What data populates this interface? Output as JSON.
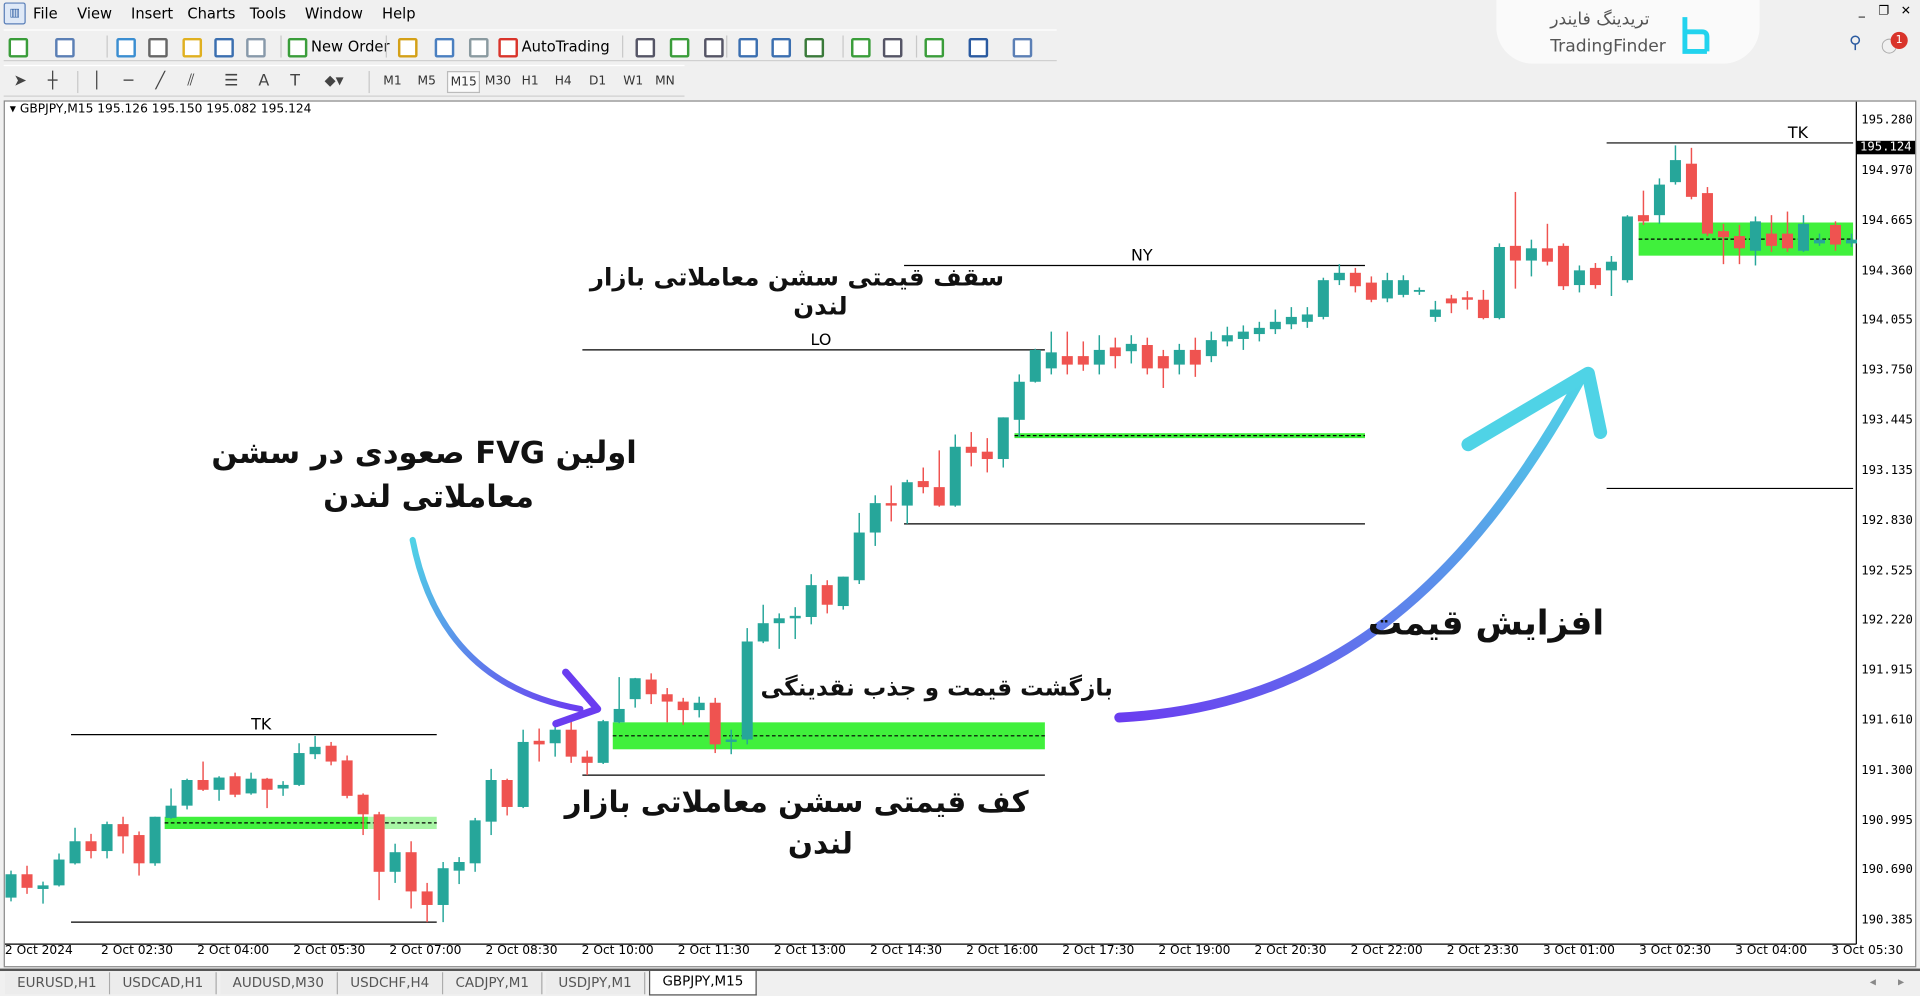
{
  "menu": {
    "items": [
      "File",
      "View",
      "Insert",
      "Charts",
      "Tools",
      "Window",
      "Help"
    ]
  },
  "window_controls": [
    "minimize",
    "restore",
    "close"
  ],
  "logo": {
    "text_fa": "تریدینگ فایندر",
    "text_en": "TradingFinder"
  },
  "notifications": {
    "count": "1"
  },
  "toolbar1": {
    "new_order": "New Order",
    "autotrading": "AutoTrading",
    "icons": [
      "new-chart-icon",
      "profiles-icon",
      "market-watch-icon",
      "data-window-icon",
      "navigator-icon",
      "terminal-icon",
      "strategy-tester-icon",
      "new-order-icon",
      "metaeditor-icon",
      "signals-icon",
      "broadcast-icon",
      "autotrading-icon",
      "bar-chart-icon",
      "candlestick-chart-icon",
      "line-chart-icon",
      "zoom-in-icon",
      "zoom-out-icon",
      "tile-windows-icon",
      "chart-shift-icon",
      "autoscroll-icon",
      "indicators-icon",
      "periods-icon",
      "templates-icon"
    ]
  },
  "toolbar2": {
    "tools": [
      "cursor-icon",
      "crosshair-icon",
      "vertical-line-icon",
      "horizontal-line-icon",
      "trendline-icon",
      "equidistant-channel-icon",
      "fibonacci-icon",
      "text-icon",
      "text-label-icon",
      "arrows-icon"
    ],
    "text_tool": "A",
    "label_tool": "T",
    "timeframes": [
      "M1",
      "M5",
      "M15",
      "M30",
      "H1",
      "H4",
      "D1",
      "W1",
      "MN"
    ],
    "active_timeframe": "M15"
  },
  "chart": {
    "symbol_info": "GBPJPY,M15  195.126 195.150 195.082 195.124"
  },
  "tabs": [
    {
      "label": "EURUSD,H1"
    },
    {
      "label": "USDCAD,H1"
    },
    {
      "label": "AUDUSD,M30"
    },
    {
      "label": "USDCHF,H4"
    },
    {
      "label": "CADJPY,M1"
    },
    {
      "label": "USDJPY,M1"
    },
    {
      "label": "GBPJPY,M15",
      "active": true
    }
  ],
  "annotations": {
    "london_high_1": "سقف قیمتی سشن معاملاتی بازار",
    "london_high_2": "لندن",
    "first_fvg_1": "اولین FVG صعودی در سشن",
    "first_fvg_2": "معاملاتی لندن",
    "pullback": "بازگشت قیمت و جذب نقدینگی",
    "london_low_1": "کف قیمتی سشن معاملاتی بازار",
    "london_low_2": "لندن",
    "price_rise": "افزایش قیمت"
  },
  "colors": {
    "bull": "#26a69a",
    "bear": "#ef5350",
    "fvg": "#40f03c",
    "fvg_mitigated": "#a8f5a5",
    "arrow_start": "#4fd3e6",
    "arrow_end": "#6a3df0"
  },
  "chart_data": {
    "type": "candlestick",
    "symbol": "GBPJPY",
    "timeframe": "M15",
    "ylim": [
      190.385,
      195.28
    ],
    "current_price": "195.124",
    "y_ticks": [
      "195.280",
      "194.970",
      "194.665",
      "194.360",
      "194.055",
      "193.750",
      "193.445",
      "193.135",
      "192.830",
      "192.525",
      "192.220",
      "191.915",
      "191.610",
      "191.300",
      "190.995",
      "190.690",
      "190.385"
    ],
    "x_ticks": [
      "2 Oct 2024",
      "2 Oct 02:30",
      "2 Oct 04:00",
      "2 Oct 05:30",
      "2 Oct 07:00",
      "2 Oct 08:30",
      "2 Oct 10:00",
      "2 Oct 11:30",
      "2 Oct 13:00",
      "2 Oct 14:30",
      "2 Oct 16:00",
      "2 Oct 17:30",
      "2 Oct 19:00",
      "2 Oct 20:30",
      "2 Oct 22:00",
      "2 Oct 23:30",
      "3 Oct 01:00",
      "3 Oct 02:30",
      "3 Oct 04:00",
      "3 Oct 05:30"
    ],
    "candles_ohlc": [
      [
        190.542,
        190.707,
        190.519,
        190.685
      ],
      [
        190.685,
        190.737,
        190.565,
        190.602
      ],
      [
        190.595,
        190.64,
        190.505,
        190.617
      ],
      [
        190.617,
        190.812,
        190.61,
        190.775
      ],
      [
        190.752,
        190.97,
        190.745,
        190.887
      ],
      [
        190.887,
        190.932,
        190.782,
        190.827
      ],
      [
        190.827,
        191.007,
        190.782,
        190.992
      ],
      [
        190.992,
        191.037,
        190.812,
        190.917
      ],
      [
        190.925,
        190.947,
        190.677,
        190.752
      ],
      [
        190.752,
        191.037,
        190.737,
        191.037
      ],
      [
        191.03,
        191.21,
        191.025,
        191.105
      ],
      [
        191.105,
        191.27,
        191.082,
        191.262
      ],
      [
        191.262,
        191.375,
        191.195,
        191.202
      ],
      [
        191.202,
        191.285,
        191.135,
        191.277
      ],
      [
        191.285,
        191.307,
        191.157,
        191.172
      ],
      [
        191.18,
        191.307,
        191.172,
        191.27
      ],
      [
        191.27,
        191.275,
        191.09,
        191.202
      ],
      [
        191.21,
        191.255,
        191.165,
        191.232
      ],
      [
        191.232,
        191.487,
        191.225,
        191.427
      ],
      [
        191.42,
        191.532,
        191.39,
        191.465
      ],
      [
        191.472,
        191.495,
        191.352,
        191.375
      ],
      [
        191.382,
        191.412,
        191.15,
        191.165
      ],
      [
        191.172,
        191.18,
        190.925,
        191.052
      ],
      [
        191.052,
        191.067,
        190.527,
        190.7
      ],
      [
        190.7,
        190.872,
        190.632,
        190.82
      ],
      [
        190.82,
        190.887,
        190.475,
        190.58
      ],
      [
        190.58,
        190.632,
        190.392,
        190.497
      ],
      [
        190.497,
        190.76,
        190.392,
        190.722
      ],
      [
        190.707,
        190.79,
        190.625,
        190.76
      ],
      [
        190.752,
        191.03,
        190.7,
        191.015
      ],
      [
        191.007,
        191.33,
        190.925,
        191.262
      ],
      [
        191.262,
        191.27,
        191.045,
        191.097
      ],
      [
        191.097,
        191.57,
        191.09,
        191.495
      ],
      [
        191.502,
        191.577,
        191.375,
        191.48
      ],
      [
        191.487,
        191.6,
        191.405,
        191.57
      ],
      [
        191.57,
        191.66,
        191.367,
        191.405
      ],
      [
        191.405,
        191.442,
        191.292,
        191.367
      ],
      [
        191.367,
        191.63,
        191.36,
        191.622
      ],
      [
        191.615,
        191.892,
        191.61,
        191.697
      ],
      [
        191.757,
        191.887,
        191.705,
        191.885
      ],
      [
        191.877,
        191.915,
        191.727,
        191.787
      ],
      [
        191.787,
        191.825,
        191.615,
        191.742
      ],
      [
        191.742,
        191.765,
        191.6,
        191.69
      ],
      [
        191.69,
        191.772,
        191.645,
        191.735
      ],
      [
        191.735,
        191.765,
        191.427,
        191.48
      ],
      [
        191.495,
        191.57,
        191.42,
        191.51
      ],
      [
        191.51,
        192.192,
        191.48,
        192.11
      ],
      [
        192.11,
        192.335,
        192.1,
        192.222
      ],
      [
        192.222,
        192.282,
        192.065,
        192.252
      ],
      [
        192.252,
        192.32,
        192.125,
        192.267
      ],
      [
        192.26,
        192.522,
        192.215,
        192.455
      ],
      [
        192.455,
        192.485,
        192.282,
        192.335
      ],
      [
        192.327,
        192.507,
        192.305,
        192.507
      ],
      [
        192.485,
        192.897,
        192.462,
        192.777
      ],
      [
        192.777,
        193.005,
        192.695,
        192.957
      ],
      [
        192.957,
        193.065,
        192.845,
        192.942
      ],
      [
        192.942,
        193.1,
        192.83,
        193.085
      ],
      [
        193.092,
        193.175,
        193.017,
        193.055
      ],
      [
        193.055,
        193.28,
        192.935,
        192.942
      ],
      [
        192.942,
        193.377,
        192.935,
        193.302
      ],
      [
        193.302,
        193.392,
        193.182,
        193.265
      ],
      [
        193.272,
        193.355,
        193.145,
        193.227
      ],
      [
        193.227,
        193.482,
        193.175,
        193.482
      ],
      [
        193.467,
        193.745,
        193.362,
        193.7
      ],
      [
        193.7,
        193.902,
        193.695,
        193.895
      ],
      [
        193.782,
        194.007,
        193.745,
        193.88
      ],
      [
        193.857,
        194.007,
        193.745,
        193.805
      ],
      [
        193.857,
        193.947,
        193.767,
        193.805
      ],
      [
        193.805,
        193.985,
        193.745,
        193.895
      ],
      [
        193.91,
        193.97,
        193.782,
        193.857
      ],
      [
        193.887,
        193.985,
        193.812,
        193.932
      ],
      [
        193.925,
        193.97,
        193.745,
        193.782
      ],
      [
        193.857,
        193.895,
        193.662,
        193.782
      ],
      [
        193.805,
        193.932,
        193.745,
        193.895
      ],
      [
        193.895,
        193.97,
        193.73,
        193.805
      ],
      [
        193.857,
        194.007,
        193.82,
        193.955
      ],
      [
        193.947,
        194.037,
        193.917,
        193.985
      ],
      [
        193.962,
        194.045,
        193.895,
        194.007
      ],
      [
        193.992,
        194.067,
        193.947,
        194.03
      ],
      [
        194.022,
        194.142,
        193.992,
        194.067
      ],
      [
        194.052,
        194.157,
        194.022,
        194.097
      ],
      [
        194.067,
        194.157,
        194.03,
        194.112
      ],
      [
        194.097,
        194.337,
        194.082,
        194.322
      ],
      [
        194.322,
        194.42,
        194.292,
        194.367
      ],
      [
        194.367,
        194.397,
        194.247,
        194.285
      ],
      [
        194.307,
        194.345,
        194.187,
        194.202
      ],
      [
        194.21,
        194.367,
        194.187,
        194.322
      ],
      [
        194.232,
        194.352,
        194.217,
        194.322
      ],
      [
        194.255,
        194.277,
        194.232,
        194.262
      ],
      [
        194.097,
        194.195,
        194.067,
        194.142
      ],
      [
        194.21,
        194.232,
        194.12,
        194.18
      ],
      [
        194.217,
        194.255,
        194.142,
        194.202
      ],
      [
        194.202,
        194.262,
        194.082,
        194.09
      ],
      [
        194.09,
        194.547,
        194.082,
        194.525
      ],
      [
        194.532,
        194.862,
        194.27,
        194.442
      ],
      [
        194.442,
        194.57,
        194.345,
        194.517
      ],
      [
        194.517,
        194.667,
        194.412,
        194.435
      ],
      [
        194.532,
        194.547,
        194.262,
        194.285
      ],
      [
        194.292,
        194.412,
        194.247,
        194.382
      ],
      [
        194.397,
        194.427,
        194.27,
        194.292
      ],
      [
        194.382,
        194.47,
        194.225,
        194.435
      ],
      [
        194.322,
        194.72,
        194.307,
        194.712
      ],
      [
        194.72,
        194.87,
        194.66,
        194.682
      ],
      [
        194.72,
        194.945,
        194.667,
        194.907
      ],
      [
        194.922,
        195.147,
        194.907,
        195.057
      ],
      [
        195.035,
        195.132,
        194.817,
        194.832
      ],
      [
        194.855,
        194.892,
        194.592,
        194.607
      ],
      [
        194.622,
        194.667,
        194.42,
        194.585
      ],
      [
        194.592,
        194.66,
        194.42,
        194.517
      ],
      [
        194.502,
        194.712,
        194.412,
        194.682
      ],
      [
        194.607,
        194.72,
        194.495,
        194.532
      ],
      [
        194.607,
        194.742,
        194.495,
        194.517
      ],
      [
        194.502,
        194.72,
        194.495,
        194.667
      ],
      [
        194.547,
        194.607,
        194.532,
        194.57
      ],
      [
        194.66,
        194.682,
        194.502,
        194.54
      ],
      [
        194.547,
        194.607,
        194.525,
        194.57
      ]
    ],
    "sessions": [
      {
        "label": "TK",
        "high": 191.54,
        "low": 190.392,
        "from_bar": 3.75,
        "to_bar": 26.6
      },
      {
        "label": "LO",
        "high": 193.895,
        "low": 191.292,
        "from_bar": 35.7,
        "to_bar": 64.6
      },
      {
        "label": "NY",
        "high": 194.412,
        "low": 192.83,
        "from_bar": 55.8,
        "to_bar": 84.6
      },
      {
        "label": "TK",
        "high": 195.162,
        "low": 193.047,
        "from_bar": 99.7,
        "to_bar": 115.1
      }
    ],
    "fvg_zones": [
      {
        "top": 191.037,
        "bottom": 190.962,
        "from_bar": 9.6,
        "to_bar": 26.6,
        "mitigated_from_bar": 22.3
      },
      {
        "top": 191.615,
        "bottom": 191.45,
        "from_bar": 37.6,
        "to_bar": 64.6
      },
      {
        "top": 193.385,
        "bottom": 193.355,
        "from_bar": 62.7,
        "to_bar": 84.6
      },
      {
        "top": 194.675,
        "bottom": 194.472,
        "from_bar": 101.7,
        "to_bar": 115.1
      }
    ]
  }
}
